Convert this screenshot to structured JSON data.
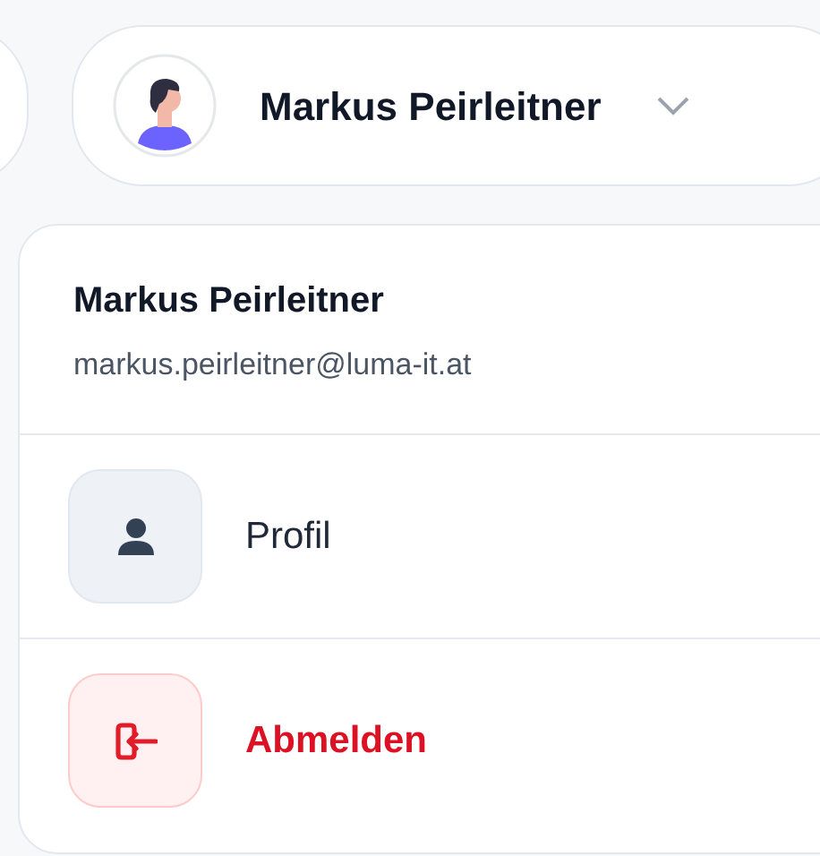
{
  "user_button": {
    "name": "Markus Peirleitner",
    "expanded": true
  },
  "menu": {
    "name": "Markus Peirleitner",
    "email": "markus.peirleitner@luma-it.at",
    "items": [
      {
        "label": "Profil",
        "kind": "profile"
      },
      {
        "label": "Abmelden",
        "kind": "logout"
      }
    ]
  }
}
